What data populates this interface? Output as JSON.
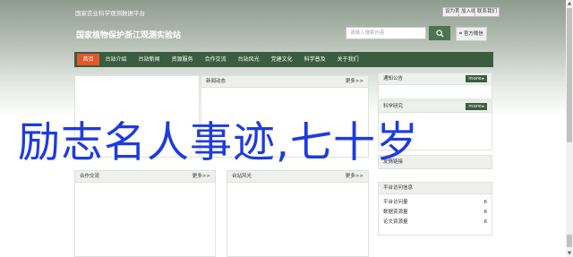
{
  "topbar": {
    "site_name": "国家农业科学观测数据平台",
    "links": [
      "设为首页",
      "加入收藏",
      "联系我们"
    ]
  },
  "header": {
    "title": "国家植物保护浙江观测实验站",
    "search_placeholder": "请输入搜索内容",
    "wechat_label": "官方微信"
  },
  "nav": {
    "items": [
      "首页",
      "台站介绍",
      "台站新闻",
      "资源服务",
      "合作交流",
      "台站风光",
      "党建文化",
      "科学普及",
      "关于我们"
    ],
    "active_index": 0
  },
  "panels": {
    "news": {
      "title": "新闻动态",
      "more": "更多>>"
    },
    "notice": {
      "title": "通知公告",
      "more": "more"
    },
    "science": {
      "title": "科学研究",
      "more": "more"
    },
    "links": {
      "title": "友情链接"
    },
    "cooperation": {
      "title": "合作交流",
      "more": "更多>>"
    },
    "scenery": {
      "title": "台站风光",
      "more": "更多>>"
    },
    "stats": {
      "title": "平台访问信息",
      "rows": [
        {
          "label": "平台访问量",
          "value": "6"
        },
        {
          "label": "数据资源量",
          "value": "6"
        },
        {
          "label": "论文资源量",
          "value": "6"
        }
      ]
    }
  },
  "overlay_text": "励志名人事迹,七十岁",
  "colors": {
    "nav_bg": "#3b5d3f",
    "nav_active": "#e3572a",
    "overlay_text": "#1e3cdc"
  }
}
